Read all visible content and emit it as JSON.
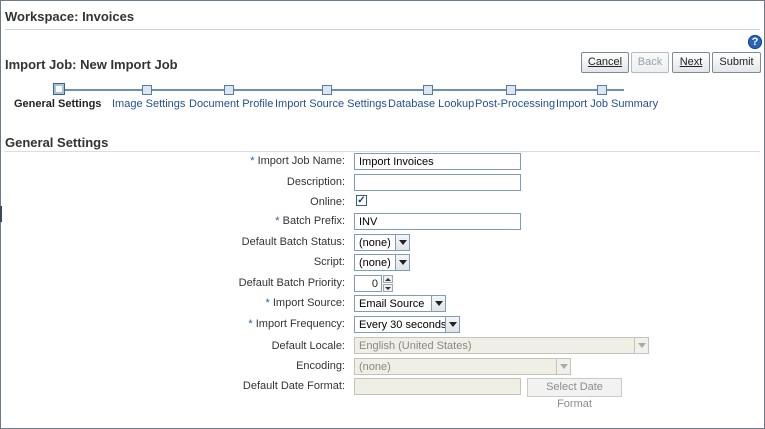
{
  "workspace": {
    "title": "Workspace: Invoices"
  },
  "job": {
    "title": "Import Job: New Import Job"
  },
  "toolbar": {
    "cancel": "Cancel",
    "back": "Back",
    "next": "Next",
    "submit": "Submit"
  },
  "train": {
    "steps": [
      {
        "label": "General Settings",
        "current": true
      },
      {
        "label": "Image Settings",
        "current": false
      },
      {
        "label": "Document Profile",
        "current": false
      },
      {
        "label": "Import Source Settings",
        "current": false
      },
      {
        "label": "Database Lookup",
        "current": false
      },
      {
        "label": "Post-Processing",
        "current": false
      },
      {
        "label": "Import Job Summary",
        "current": false
      }
    ]
  },
  "section": {
    "title": "General Settings"
  },
  "form": {
    "job_name": {
      "label": "Import Job Name:",
      "value": "Import Invoices",
      "required": "*"
    },
    "description": {
      "label": "Description:",
      "value": ""
    },
    "online": {
      "label": "Online:",
      "checked": "✓"
    },
    "batch_prefix": {
      "label": "Batch Prefix:",
      "value": "INV",
      "required": "*"
    },
    "batch_status": {
      "label": "Default Batch Status:",
      "value": "(none)"
    },
    "script": {
      "label": "Script:",
      "value": "(none)"
    },
    "batch_priority": {
      "label": "Default Batch Priority:",
      "value": "0"
    },
    "import_source": {
      "label": "Import Source:",
      "value": "Email Source",
      "required": "*"
    },
    "import_frequency": {
      "label": "Import Frequency:",
      "value": "Every 30 seconds",
      "required": "*"
    },
    "locale": {
      "label": "Default Locale:",
      "value": "English (United States)"
    },
    "encoding": {
      "label": "Encoding:",
      "value": "(none)"
    },
    "date_format": {
      "label": "Default Date Format:",
      "value": "",
      "button": "Select Date Format"
    }
  },
  "help": {
    "glyph": "?"
  },
  "colors": {
    "link": "#1f4f99",
    "required": "#1f5fb4",
    "help": "#2a64b8"
  }
}
